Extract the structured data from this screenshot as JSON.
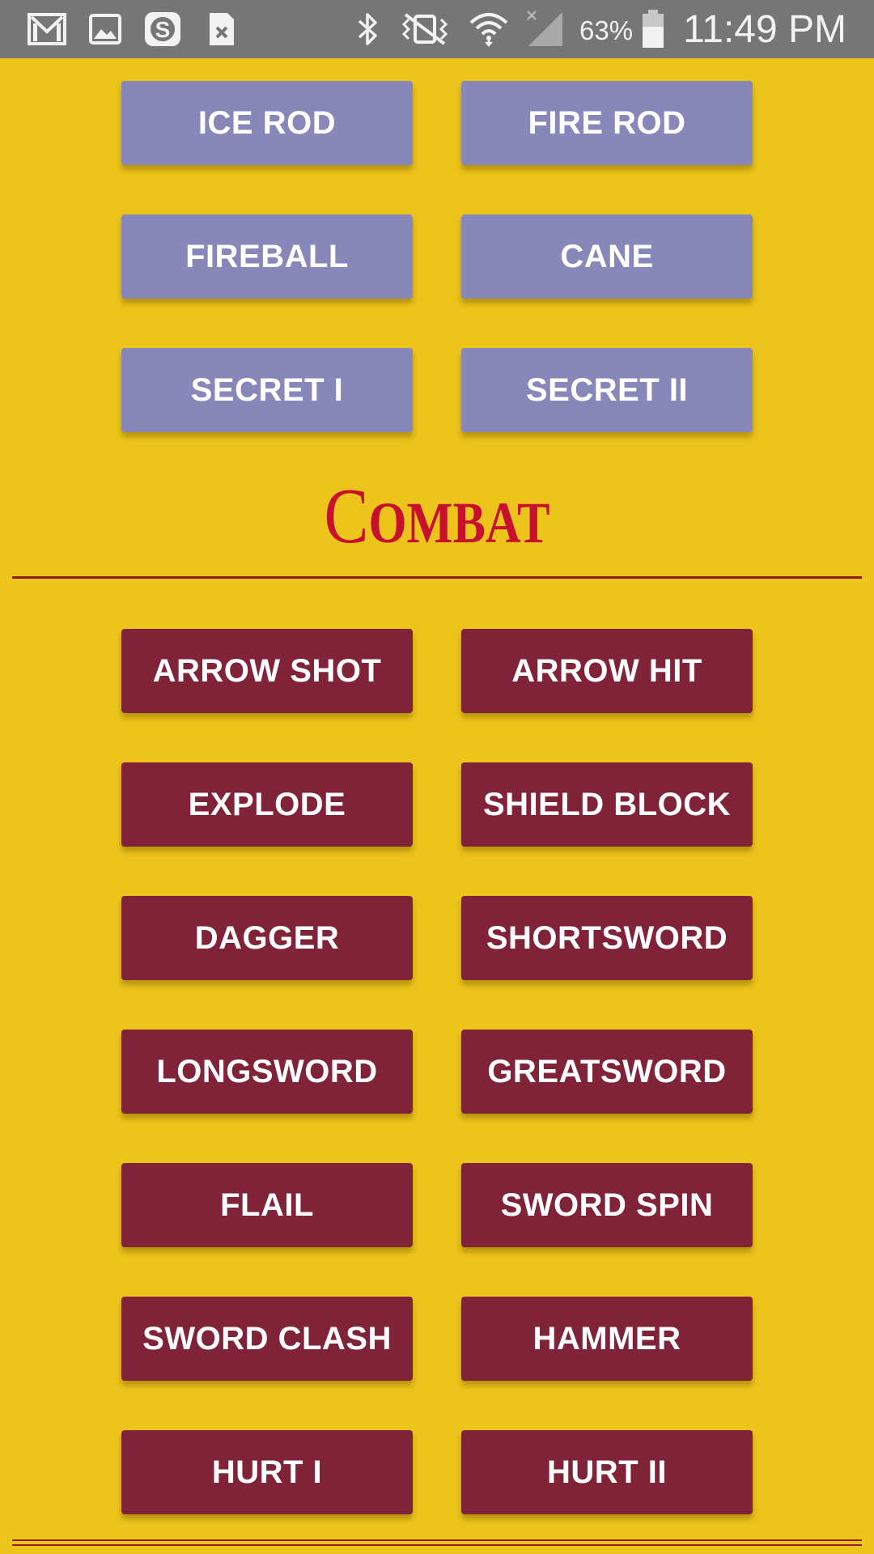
{
  "status_bar": {
    "time": "11:49 PM",
    "battery_percent": "63%",
    "icons": [
      "gmail-icon",
      "gallery-icon",
      "money-icon",
      "file-icon",
      "bluetooth-icon",
      "vibrate-mute-icon",
      "wifi-icon",
      "cellular-signal-icon",
      "battery-icon"
    ]
  },
  "magic_buttons": [
    {
      "label": "ICE ROD"
    },
    {
      "label": "FIRE ROD"
    },
    {
      "label": "FIREBALL"
    },
    {
      "label": "CANE"
    },
    {
      "label": "SECRET I"
    },
    {
      "label": "SECRET II"
    }
  ],
  "combat_section": {
    "title_initial": "C",
    "title_rest": "OMBAT",
    "buttons": [
      {
        "label": "ARROW SHOT"
      },
      {
        "label": "ARROW HIT"
      },
      {
        "label": "EXPLODE"
      },
      {
        "label": "SHIELD BLOCK"
      },
      {
        "label": "DAGGER"
      },
      {
        "label": "SHORTSWORD"
      },
      {
        "label": "LONGSWORD"
      },
      {
        "label": "GREATSWORD"
      },
      {
        "label": "FLAIL"
      },
      {
        "label": "SWORD SPIN"
      },
      {
        "label": "SWORD CLASH"
      },
      {
        "label": "HAMMER"
      },
      {
        "label": "HURT I"
      },
      {
        "label": "HURT II"
      }
    ]
  },
  "colors": {
    "background": "#ecc41b",
    "magic_button": "#8887ba",
    "combat_button": "#802238",
    "title": "#c8102e",
    "divider": "#8c1d1d",
    "status_bar": "#767676"
  }
}
